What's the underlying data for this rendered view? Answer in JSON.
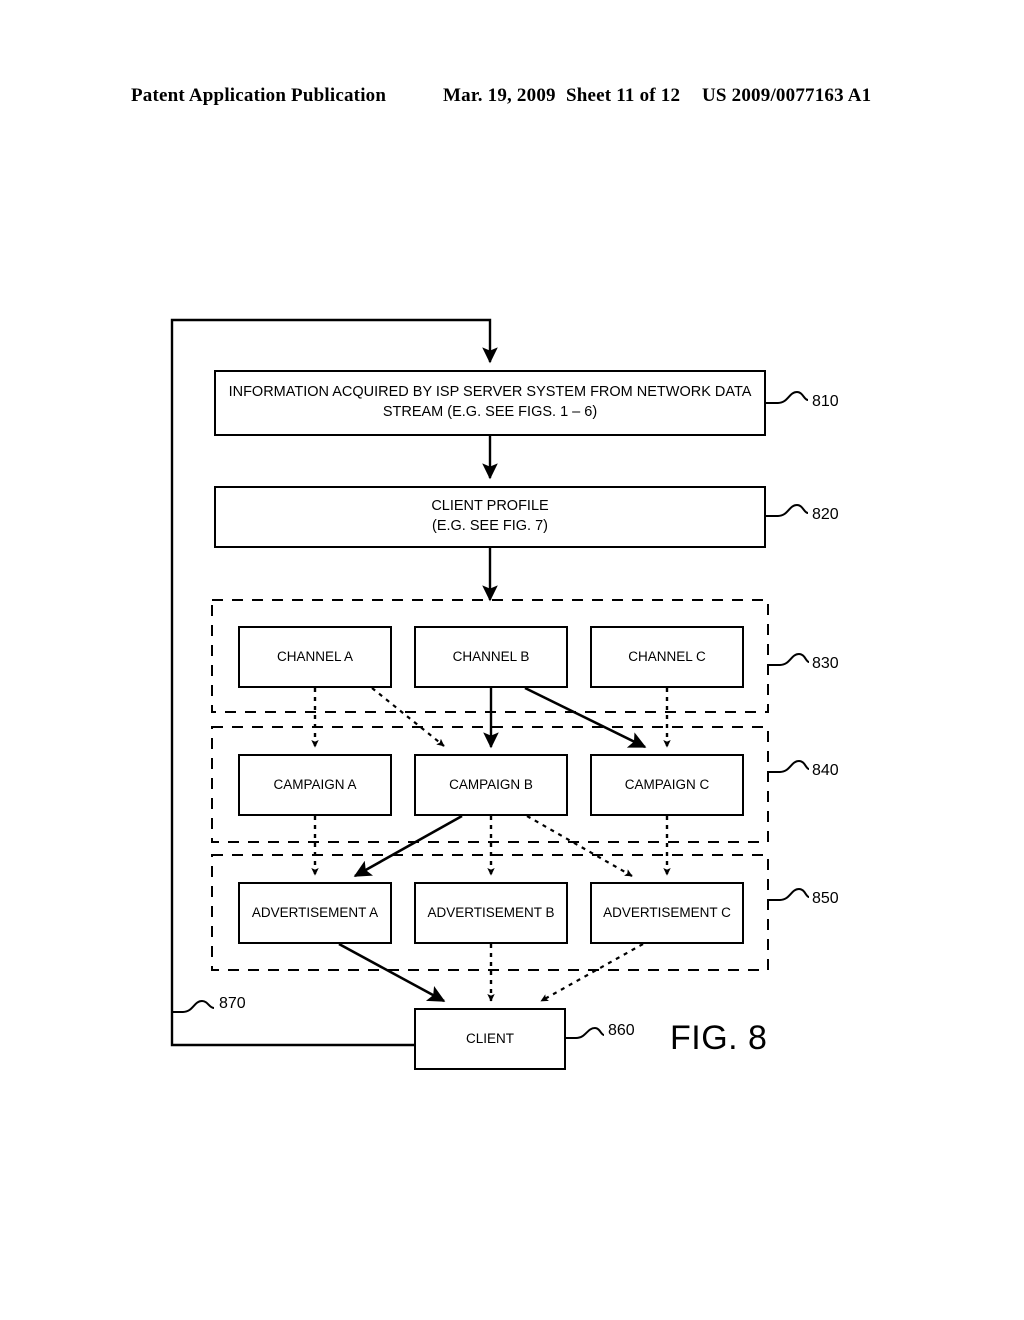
{
  "page": {
    "header": {
      "publication": "Patent Application Publication",
      "date": "Mar. 19, 2009",
      "sheet": "Sheet 11 of 12",
      "patent_number": "US 2009/0077163 A1"
    },
    "figure_caption": "FIG. 8"
  },
  "diagram": {
    "boxes": {
      "information": {
        "label": "INFORMATION ACQUIRED BY ISP SERVER SYSTEM FROM NETWORK DATA\nSTREAM (E.G. SEE FIGS. 1 – 6)",
        "ref": "810"
      },
      "client_profile": {
        "label": "CLIENT PROFILE\n(E.G. SEE FIG. 7)",
        "ref": "820"
      },
      "client": {
        "label": "CLIENT",
        "ref": "860"
      }
    },
    "groups": {
      "channels": {
        "ref": "830",
        "nodes": [
          {
            "label": "CHANNEL A"
          },
          {
            "label": "CHANNEL B"
          },
          {
            "label": "CHANNEL C"
          }
        ]
      },
      "campaigns": {
        "ref": "840",
        "nodes": [
          {
            "label": "CAMPAIGN A"
          },
          {
            "label": "CAMPAIGN B"
          },
          {
            "label": "CAMPAIGN C"
          }
        ]
      },
      "advertisements": {
        "ref": "850",
        "nodes": [
          {
            "label": "ADVERTISEMENT A"
          },
          {
            "label": "ADVERTISEMENT B"
          },
          {
            "label": "ADVERTISEMENT C"
          }
        ]
      }
    },
    "feedback_loop": {
      "ref": "870"
    },
    "colors": {
      "line": "#000000",
      "background": "#ffffff"
    }
  }
}
